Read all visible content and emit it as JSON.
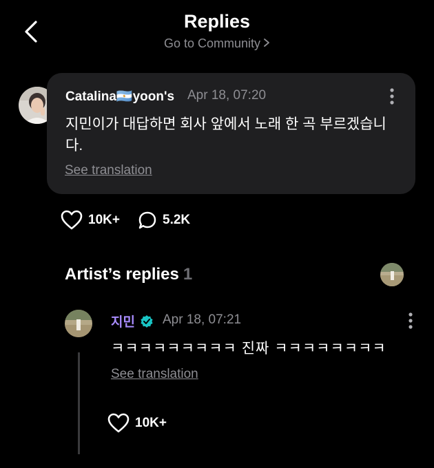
{
  "header": {
    "title": "Replies",
    "subtitle": "Go to Community"
  },
  "comment": {
    "author": "Catalina🇦🇷yoon's",
    "date": "Apr 18, 07:20",
    "text": "지민이가 대답하면 회사 앞에서 노래 한 곡 부르겠습니다.",
    "see_translation": "See translation",
    "likes": "10K+",
    "replies": "5.2K"
  },
  "artist_replies": {
    "label": "Artist’s replies",
    "count": "1"
  },
  "reply": {
    "author": "지민",
    "date": "Apr 18, 07:21",
    "text": "ㅋㅋㅋㅋㅋㅋㅋㅋㅋ 진짜 ㅋㅋㅋㅋㅋㅋㅋㅋ",
    "see_translation": "See translation",
    "likes": "10K+"
  },
  "colors": {
    "background": "#000000",
    "card": "#1f1f21",
    "muted": "#8e8e93",
    "artist_name": "#a98cff",
    "verified": "#19c4c4"
  },
  "icons": [
    "back-arrow-icon",
    "chevron-right-icon",
    "more-vertical-icon",
    "heart-icon",
    "comment-bubble-icon",
    "verified-badge-icon"
  ]
}
